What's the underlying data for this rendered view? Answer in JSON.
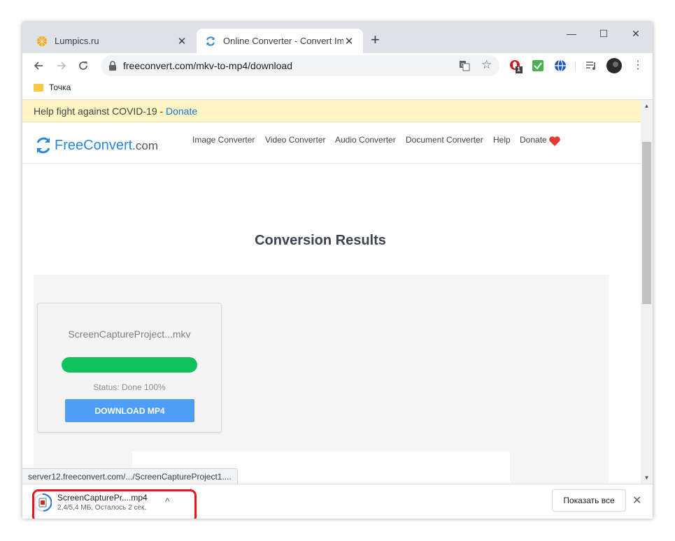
{
  "tabs": [
    {
      "title": "Lumpics.ru",
      "active": false
    },
    {
      "title": "Online Converter - Convert Image",
      "active": true
    }
  ],
  "window_controls": {
    "minimize": "—",
    "maximize": "☐",
    "close": "✕"
  },
  "toolbar": {
    "url": "freeconvert.com/mkv-to-mp4/download",
    "badge_count": "1"
  },
  "bookmarks": [
    {
      "label": "Точка"
    }
  ],
  "banner": {
    "text": "Help fight against COVID-19 - ",
    "link": "Donate"
  },
  "site": {
    "logo_free": "Free",
    "logo_convert": "Convert",
    "logo_com": ".com",
    "nav": [
      "Image Converter",
      "Video Converter",
      "Audio Converter",
      "Document Converter",
      "Help",
      "Donate"
    ]
  },
  "main": {
    "heading": "Conversion Results",
    "card": {
      "filename": "ScreenCaptureProject...mkv",
      "progress": 1.0,
      "status": "Status: Done 100%",
      "button": "DOWNLOAD MP4"
    }
  },
  "status_url": "server12.freeconvert.com/.../ScreenCaptureProject1....",
  "download_shelf": {
    "file_name": "ScreenCapturePr....mp4",
    "progress_text": "2,4/5,4 МБ, Осталось 2 сек.",
    "show_all": "Показать все"
  },
  "colors": {
    "accent": "#2c87d8",
    "progress_green": "#0fc25b",
    "download_button": "#4f9ef5",
    "banner_bg": "#fdf5c4",
    "highlight": "#e8141f"
  }
}
